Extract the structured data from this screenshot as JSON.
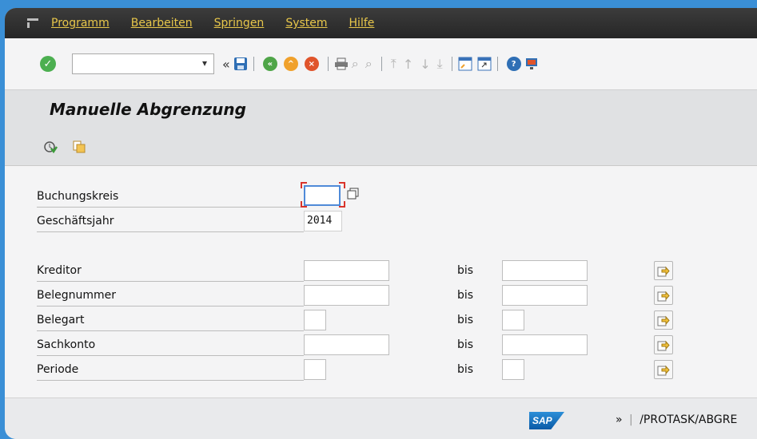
{
  "menubar": {
    "items": [
      "Programm",
      "Bearbeiten",
      "Springen",
      "System",
      "Hilfe"
    ]
  },
  "toolbar": {
    "command_value": "",
    "icons": [
      "enter-icon",
      "command-dropdown-icon",
      "collapse-icon",
      "save-icon",
      "back-icon",
      "exit-icon",
      "cancel-icon",
      "print-icon",
      "find-icon",
      "find-next-icon",
      "first-page-icon",
      "previous-page-icon",
      "next-page-icon",
      "last-page-icon",
      "create-session-icon",
      "shortcut-icon",
      "help-icon",
      "customize-layout-icon"
    ]
  },
  "header": {
    "title": "Manuelle Abgrenzung"
  },
  "form": {
    "buchungskreis_label": "Buchungskreis",
    "buchungskreis_value": "",
    "geschaeftsjahr_label": "Geschäftsjahr",
    "geschaeftsjahr_value": "2014",
    "range_to_label": "bis",
    "ranges": [
      {
        "label": "Kreditor",
        "from": "",
        "to": ""
      },
      {
        "label": "Belegnummer",
        "from": "",
        "to": ""
      },
      {
        "label": "Belegart",
        "from": "",
        "to": ""
      },
      {
        "label": "Sachkonto",
        "from": "",
        "to": ""
      },
      {
        "label": "Periode",
        "from": "",
        "to": ""
      }
    ]
  },
  "status": {
    "logo_text": "SAP",
    "arrows": "»",
    "separator": "|",
    "transaction": "/PROTASK/ABGRE"
  },
  "colors": {
    "menubar_bg": "#2f2f2f",
    "menu_text": "#e8c74a",
    "accent_blue": "#3a8fd6",
    "focus_red": "#d9342b"
  }
}
